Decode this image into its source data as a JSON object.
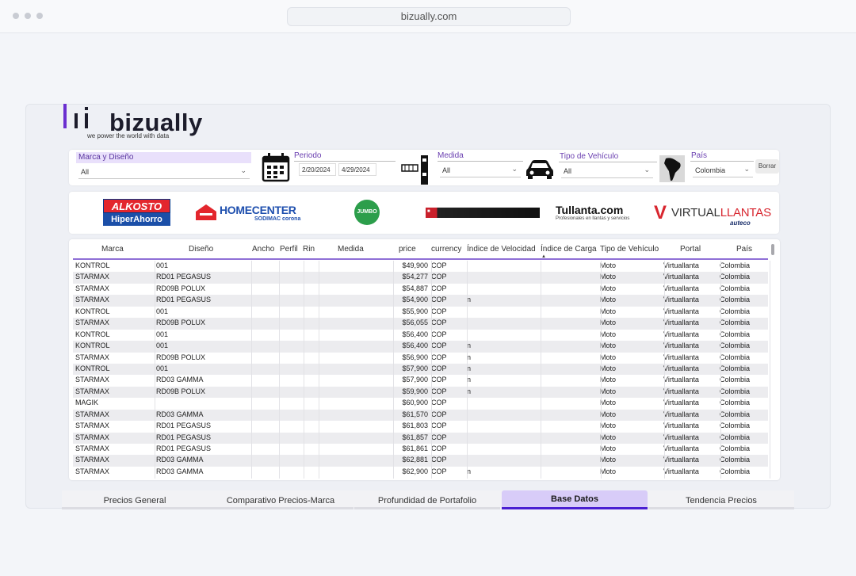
{
  "browser": {
    "url": "bizually.com"
  },
  "logo": {
    "name": "bizually",
    "tagline": "we power the world with data"
  },
  "filters": {
    "marca": {
      "label": "Marca y Diseño",
      "value": "All"
    },
    "periodo": {
      "label": "Periodo",
      "start": "2/20/2024",
      "end": "4/29/2024"
    },
    "medida": {
      "label": "Medida",
      "value": "All"
    },
    "tipo": {
      "label": "Tipo de Vehículo",
      "value": "All"
    },
    "pais": {
      "label": "País",
      "value": "Colombia"
    },
    "reset": "Borrar"
  },
  "brands": {
    "alkosto_top": "ALKOSTO",
    "alkosto_bottom": "HiperAhorro",
    "homecenter": "HOMECENTER",
    "homecenter_sub": "SODIMAC corona",
    "jumbo": "JUMBO",
    "tullanta": "Tullanta.com",
    "tullanta_sub": "Profesionales en llantas y servicios",
    "virtual_a": "VIRTUAL",
    "virtual_b": "LLANTAS",
    "virtual_sub": "auteco"
  },
  "table": {
    "headers": [
      "Marca",
      "Diseño",
      "Ancho",
      "Perfil",
      "Rin",
      "Medida",
      "price",
      "currency",
      "Índice de Velocidad",
      "Índice de Carga",
      "Tipo de Vehículo",
      "Portal",
      "País"
    ],
    "rows": [
      [
        "KONTROL",
        "001",
        "",
        "",
        "",
        "",
        "$49,900",
        "COP",
        "",
        "",
        "Moto",
        "Virtuallanta",
        "Colombia"
      ],
      [
        "STARMAX",
        "RD01 PEGASUS",
        "",
        "",
        "",
        "",
        "$54,277",
        "COP",
        "",
        "",
        "Moto",
        "Virtuallanta",
        "Colombia"
      ],
      [
        "STARMAX",
        "RD09B POLUX",
        "",
        "",
        "",
        "",
        "$54,887",
        "COP",
        "",
        "",
        "Moto",
        "Virtuallanta",
        "Colombia"
      ],
      [
        "STARMAX",
        "RD01 PEGASUS",
        "",
        "",
        "",
        "",
        "$54,900",
        "COP",
        "n",
        "",
        "Moto",
        "Virtuallanta",
        "Colombia"
      ],
      [
        "KONTROL",
        "001",
        "",
        "",
        "",
        "",
        "$55,900",
        "COP",
        "",
        "",
        "Moto",
        "Virtuallanta",
        "Colombia"
      ],
      [
        "STARMAX",
        "RD09B POLUX",
        "",
        "",
        "",
        "",
        "$56,055",
        "COP",
        "",
        "",
        "Moto",
        "Virtuallanta",
        "Colombia"
      ],
      [
        "KONTROL",
        "001",
        "",
        "",
        "",
        "",
        "$56,400",
        "COP",
        "",
        "",
        "Moto",
        "Virtuallanta",
        "Colombia"
      ],
      [
        "KONTROL",
        "001",
        "",
        "",
        "",
        "",
        "$56,400",
        "COP",
        "n",
        "",
        "Moto",
        "Virtuallanta",
        "Colombia"
      ],
      [
        "STARMAX",
        "RD09B POLUX",
        "",
        "",
        "",
        "",
        "$56,900",
        "COP",
        "n",
        "",
        "Moto",
        "Virtuallanta",
        "Colombia"
      ],
      [
        "KONTROL",
        "001",
        "",
        "",
        "",
        "",
        "$57,900",
        "COP",
        "n",
        "",
        "Moto",
        "Virtuallanta",
        "Colombia"
      ],
      [
        "STARMAX",
        "RD03 GAMMA",
        "",
        "",
        "",
        "",
        "$57,900",
        "COP",
        "n",
        "",
        "Moto",
        "Virtuallanta",
        "Colombia"
      ],
      [
        "STARMAX",
        "RD09B POLUX",
        "",
        "",
        "",
        "",
        "$59,900",
        "COP",
        "n",
        "",
        "Moto",
        "Virtuallanta",
        "Colombia"
      ],
      [
        "MAGIK",
        "",
        "",
        "",
        "",
        "",
        "$60,900",
        "COP",
        "",
        "",
        "Moto",
        "Virtuallanta",
        "Colombia"
      ],
      [
        "STARMAX",
        "RD03 GAMMA",
        "",
        "",
        "",
        "",
        "$61,570",
        "COP",
        "",
        "",
        "Moto",
        "Virtuallanta",
        "Colombia"
      ],
      [
        "STARMAX",
        "RD01 PEGASUS",
        "",
        "",
        "",
        "",
        "$61,803",
        "COP",
        "",
        "",
        "Moto",
        "Virtuallanta",
        "Colombia"
      ],
      [
        "STARMAX",
        "RD01 PEGASUS",
        "",
        "",
        "",
        "",
        "$61,857",
        "COP",
        "",
        "",
        "Moto",
        "Virtuallanta",
        "Colombia"
      ],
      [
        "STARMAX",
        "RD01 PEGASUS",
        "",
        "",
        "",
        "",
        "$61,861",
        "COP",
        "",
        "",
        "Moto",
        "Virtuallanta",
        "Colombia"
      ],
      [
        "STARMAX",
        "RD03 GAMMA",
        "",
        "",
        "",
        "",
        "$62,881",
        "COP",
        "",
        "",
        "Moto",
        "Virtuallanta",
        "Colombia"
      ],
      [
        "STARMAX",
        "RD03 GAMMA",
        "",
        "",
        "",
        "",
        "$62,900",
        "COP",
        "n",
        "",
        "Moto",
        "Virtuallanta",
        "Colombia"
      ]
    ]
  },
  "tabs": [
    {
      "label": "Precios General",
      "active": false
    },
    {
      "label": "Comparativo Precios-Marca",
      "active": false
    },
    {
      "label": "Profundidad de Portafolio",
      "active": false
    },
    {
      "label": "Base Datos",
      "active": true
    },
    {
      "label": "Tendencia Precios",
      "active": false
    }
  ],
  "colors": {
    "accent": "#4a1fd2",
    "accent_light": "#d8ccf8",
    "filter_label": "#6a3fb0"
  }
}
